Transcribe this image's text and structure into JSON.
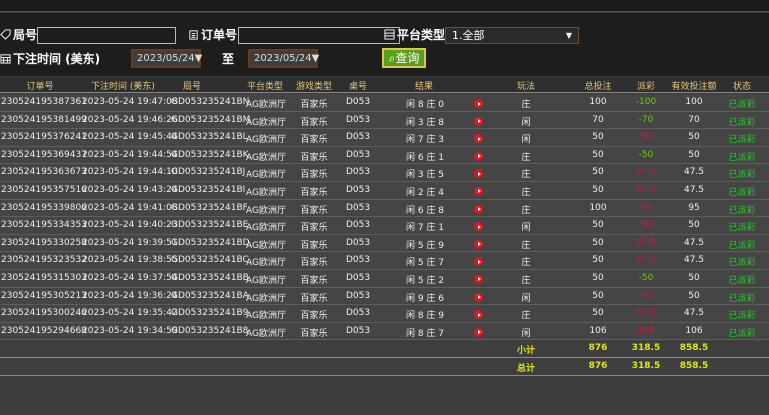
{
  "filters": {
    "round_label": "局号",
    "round_value": "",
    "order_label": "订单号",
    "order_value": "",
    "platform_label": "平台类型",
    "platform_value": "1.全部",
    "time_label": "下注时间 (美东)",
    "date_from": "2023/05/24",
    "to_label": "至",
    "date_to": "2023/05/24",
    "query_label": "查询"
  },
  "columns": [
    "订单号",
    "下注时间 (美东)",
    "局号",
    "平台类型",
    "游戏类型",
    "桌号",
    "结果",
    "玩法",
    "总投注",
    "派彩",
    "有效投注额",
    "状态"
  ],
  "rows": [
    [
      "230524195387361",
      "2023-05-24 19:47:08",
      "GD053235241BN",
      "AG欧洲厅",
      "百家乐",
      "D053",
      "闲 8 庄 0",
      "庄",
      "100",
      "-100",
      "100",
      "已派彩"
    ],
    [
      "230524195381499",
      "2023-05-24 19:46:26",
      "GD053235241BM",
      "AG欧洲厅",
      "百家乐",
      "D053",
      "闲 3 庄 8",
      "闲",
      "70",
      "-70",
      "70",
      "已派彩"
    ],
    [
      "230524195376241",
      "2023-05-24 19:45:44",
      "GD053235241BL",
      "AG欧洲厅",
      "百家乐",
      "D053",
      "闲 7 庄 3",
      "闲",
      "50",
      "50",
      "50",
      "已派彩"
    ],
    [
      "230524195369437",
      "2023-05-24 19:44:54",
      "GD053235241BK",
      "AG欧洲厅",
      "百家乐",
      "D053",
      "闲 6 庄 1",
      "庄",
      "50",
      "-50",
      "50",
      "已派彩"
    ],
    [
      "230524195363673",
      "2023-05-24 19:44:10",
      "GD053235241BJ",
      "AG欧洲厅",
      "百家乐",
      "D053",
      "闲 3 庄 5",
      "庄",
      "50",
      "47.5",
      "47.5",
      "已派彩"
    ],
    [
      "230524195357516",
      "2023-05-24 19:43:24",
      "GD053235241BI",
      "AG欧洲厅",
      "百家乐",
      "D053",
      "闲 2 庄 4",
      "庄",
      "50",
      "47.5",
      "47.5",
      "已派彩"
    ],
    [
      "230524195339806",
      "2023-05-24 19:41:08",
      "GD053235241BF",
      "AG欧洲厅",
      "百家乐",
      "D053",
      "闲 6 庄 8",
      "庄",
      "100",
      "95",
      "95",
      "已派彩"
    ],
    [
      "230524195334353",
      "2023-05-24 19:40:23",
      "GD053235241BE",
      "AG欧洲厅",
      "百家乐",
      "D053",
      "闲 7 庄 1",
      "闲",
      "50",
      "50",
      "50",
      "已派彩"
    ],
    [
      "230524195330258",
      "2023-05-24 19:39:51",
      "GD053235241BD",
      "AG欧洲厅",
      "百家乐",
      "D053",
      "闲 5 庄 9",
      "庄",
      "50",
      "47.5",
      "47.5",
      "已派彩"
    ],
    [
      "230524195323532",
      "2023-05-24 19:38:55",
      "GD053235241BC",
      "AG欧洲厅",
      "百家乐",
      "D053",
      "闲 5 庄 7",
      "庄",
      "50",
      "47.5",
      "47.5",
      "已派彩"
    ],
    [
      "230524195315303",
      "2023-05-24 19:37:54",
      "GD053235241BB",
      "AG欧洲厅",
      "百家乐",
      "D053",
      "闲 5 庄 2",
      "庄",
      "50",
      "-50",
      "50",
      "已派彩"
    ],
    [
      "230524195305213",
      "2023-05-24 19:36:24",
      "GD053235241BA",
      "AG欧洲厅",
      "百家乐",
      "D053",
      "闲 9 庄 6",
      "闲",
      "50",
      "50",
      "50",
      "已派彩"
    ],
    [
      "230524195300246",
      "2023-05-24 19:35:42",
      "GD053235241B9",
      "AG欧洲厅",
      "百家乐",
      "D053",
      "闲 8 庄 9",
      "庄",
      "50",
      "47.5",
      "47.5",
      "已派彩"
    ],
    [
      "230524195294668",
      "2023-05-24 19:34:59",
      "GD053235241B8",
      "AG欧洲厅",
      "百家乐",
      "D053",
      "闲 8 庄 7",
      "闲",
      "106",
      "106",
      "106",
      "已派彩"
    ]
  ],
  "subtotal": {
    "label": "小计",
    "bet": "876",
    "payout": "318.5",
    "valid": "858.5"
  },
  "total": {
    "label": "总计",
    "bet": "876",
    "payout": "318.5",
    "valid": "858.5"
  },
  "colors": {
    "negative": "#66cc00",
    "positive": "#d0143c",
    "status": "#20d020",
    "header": "#e8c77a",
    "summary": "#e6e600"
  }
}
